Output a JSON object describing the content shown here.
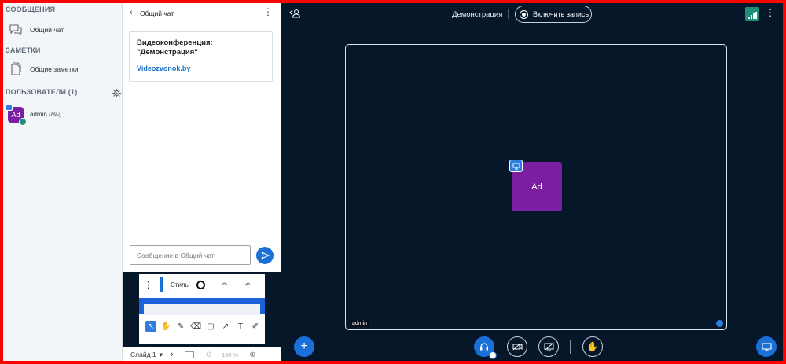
{
  "userlist": {
    "messages_title": "СООБЩЕНИЯ",
    "public_chat": "Общий чат",
    "notes_title": "ЗАМЕТКИ",
    "shared_notes": "Общие заметки",
    "users_title": "ПОЛЬЗОВАТЕЛИ (1)",
    "users": [
      {
        "avatar": "Ad",
        "name": "admin",
        "suffix": "(Вы)"
      }
    ]
  },
  "chat": {
    "title": "Общий чат",
    "welcome_title": "Видеоконференция: \"Демонстрация\"",
    "welcome_link": "Videozvonok.by",
    "input_placeholder": "Сообщение в Общий чат"
  },
  "presentation": {
    "style_label": "Стиль",
    "slide_label": "Слайд 1",
    "zoom": "100 %"
  },
  "topbar": {
    "meeting_name": "Демонстрация",
    "record_label": "Включить запись"
  },
  "video": {
    "presenter_avatar": "Ad",
    "label": "admin"
  },
  "colors": {
    "background": "#06172a",
    "accent": "#1b70d8",
    "avatar": "#7a1fa2",
    "border": "#ff0000"
  }
}
